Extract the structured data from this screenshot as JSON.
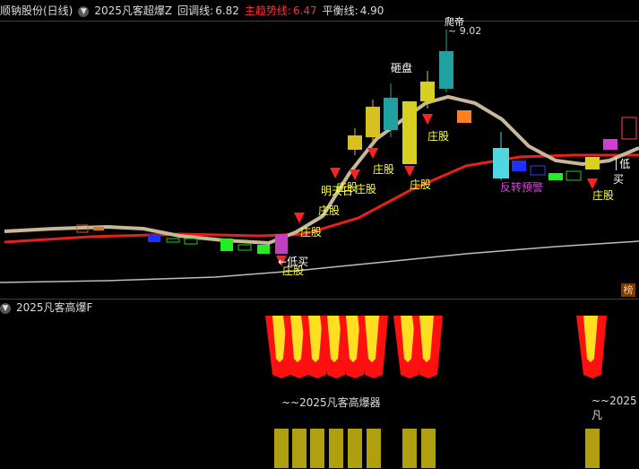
{
  "main_header": {
    "stock": "顺钠股份(日线)",
    "indicator": "2025凡客超爆Z",
    "pullback_label": "回调线:",
    "pullback_value": "6.82",
    "trend_label": "主趋势线:",
    "trend_value": "6.47",
    "balance_label": "平衡线:",
    "balance_value": "4.90"
  },
  "sub_header": {
    "indicator": "2025凡客高爆F"
  },
  "price_labels": {
    "peak": "9.02",
    "peak_tag": "爬帝",
    "smash": "砸盘"
  },
  "signals": {
    "zhuanggu": "庄股",
    "dimai": "低买",
    "mingtian": "明天日",
    "fanzhuan": "反转预警"
  },
  "sub_labels": {
    "left": "~~2025凡客高爆器",
    "right": "~~2025凡"
  },
  "badge": "榜",
  "colors": {
    "background": "#000000",
    "trend_line": "#e8201c",
    "pullback_line": "#c8b89a",
    "balance_line": "#bdbdbd",
    "signal_yellow": "#ffff40",
    "signal_magenta": "#e040e0"
  }
}
